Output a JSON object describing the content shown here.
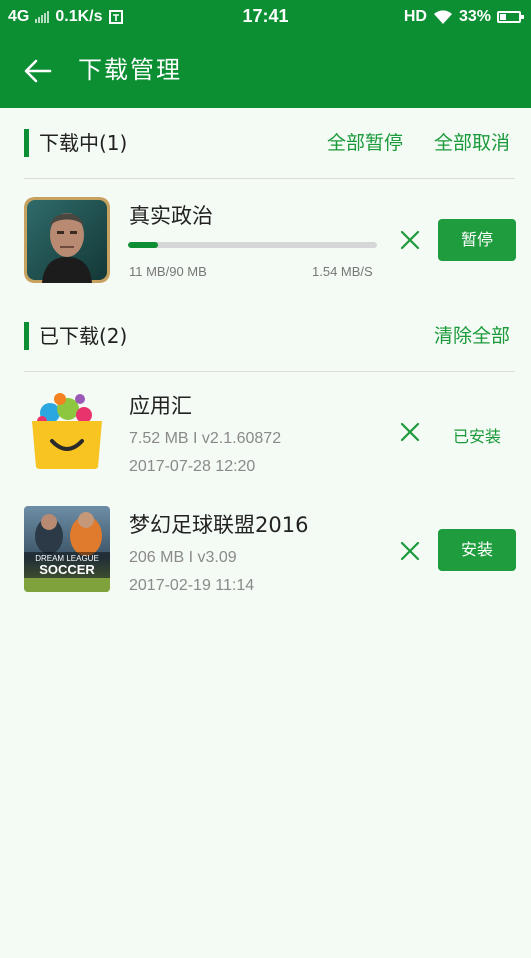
{
  "status_bar": {
    "network": "4G",
    "speed": "0.1K/s",
    "time": "17:41",
    "hd": "HD",
    "battery": "33%"
  },
  "app_bar": {
    "title": "下载管理"
  },
  "downloading": {
    "header": "下载中(1)",
    "pause_all": "全部暂停",
    "cancel_all": "全部取消",
    "items": [
      {
        "name": "真实政治",
        "size_progress": "11 MB/90 MB",
        "speed": "1.54 MB/S",
        "progress": 0.12,
        "button": "暂停",
        "icon": "politician-face-icon"
      }
    ]
  },
  "downloaded": {
    "header": "已下载(2)",
    "clear_all": "清除全部",
    "items": [
      {
        "name": "应用汇",
        "info": "7.52 MB I v2.1.60872",
        "date": "2017-07-28 12:20",
        "status": "已安装",
        "icon": "yingyonghui-bag-icon"
      },
      {
        "name": "梦幻足球联盟2016",
        "info": "206 MB I v3.09",
        "date": "2017-02-19 11:14",
        "button": "安装",
        "icon": "dream-league-soccer-icon",
        "icon_text": "DREAM LEAGUE SOCCER"
      }
    ]
  },
  "colors": {
    "primary": "#0b8f32",
    "accent_text": "#1a9a3a",
    "button": "#1f9d3e",
    "background": "#f4faf4"
  }
}
